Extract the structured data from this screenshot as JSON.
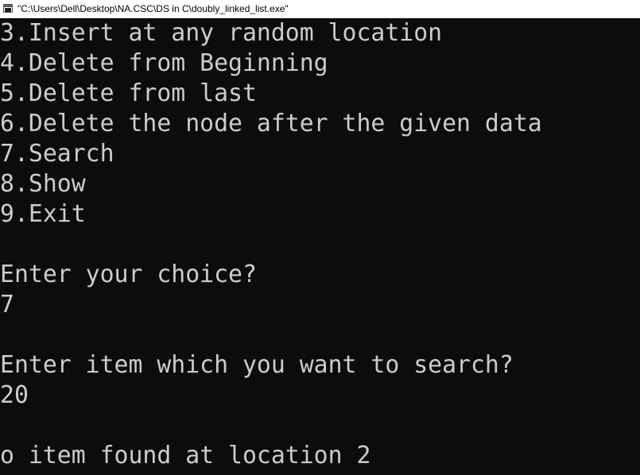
{
  "window": {
    "title": "\"C:\\Users\\Dell\\Desktop\\NA.CSC\\DS in C\\doubly_linked_list.exe\"",
    "icon": "console-app-icon"
  },
  "console": {
    "lines": [
      "3.Insert at any random location",
      "4.Delete from Beginning",
      "5.Delete from last",
      "6.Delete the node after the given data",
      "7.Search",
      "8.Show",
      "9.Exit",
      "",
      "Enter your choice?",
      "7",
      "",
      "Enter item which you want to search?",
      "20",
      "",
      "o item found at location 2"
    ]
  },
  "colors": {
    "background": "#0c0c0c",
    "text": "#cccccc",
    "titlebar": "#ffffff"
  }
}
